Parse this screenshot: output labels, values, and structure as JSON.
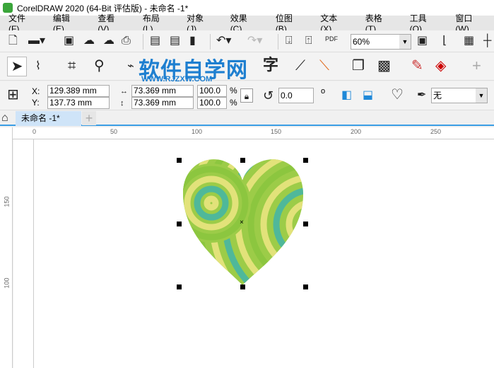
{
  "window": {
    "title": "CorelDRAW 2020 (64-Bit 评估版) - 未命名 -1*"
  },
  "menu": [
    "文件(F)",
    "编辑(E)",
    "查看(V)",
    "布局(L)",
    "对象(J)",
    "效果(C)",
    "位图(B)",
    "文本(X)",
    "表格(T)",
    "工具(O)",
    "窗口(W)"
  ],
  "toolbar": {
    "zoom": "60%",
    "pdf": "PDF"
  },
  "watermark": {
    "title": "软件自学网",
    "url": "WWW.RJZXW.COM"
  },
  "props": {
    "x_label": "X:",
    "y_label": "Y:",
    "x": "129.389 mm",
    "y": "137.73 mm",
    "w": "73.369 mm",
    "h": "73.369 mm",
    "sx": "100.0",
    "sy": "100.0",
    "pct": "%",
    "rot": "0.0",
    "deg": "o",
    "outline": "无"
  },
  "tabs": {
    "doc": "未命名 -1*",
    "add": "+"
  },
  "ruler": {
    "h": [
      "0",
      "50",
      "100",
      "150",
      "200",
      "250"
    ],
    "v": [
      "150",
      "100"
    ]
  },
  "colors": {
    "accent": "#3a9ee4",
    "ring_green": "#8cc63f",
    "ring_yellow": "#e2e27a",
    "ring_teal": "#4fb89a"
  }
}
